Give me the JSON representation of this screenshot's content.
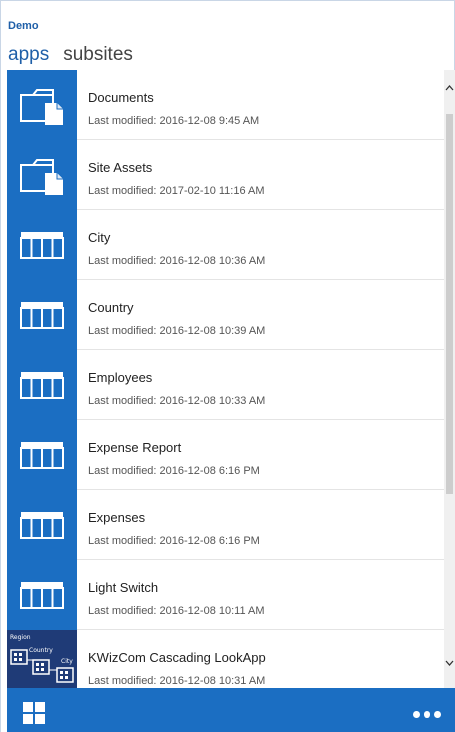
{
  "site": {
    "title": "Demo"
  },
  "tabs": [
    {
      "label": "apps",
      "active": true
    },
    {
      "label": "subsites",
      "active": false
    }
  ],
  "items": [
    {
      "name": "Documents",
      "modified": "Last modified: 2016-12-08 9:45 AM",
      "icon": "folder-document-icon"
    },
    {
      "name": "Site Assets",
      "modified": "Last modified: 2017-02-10 11:16 AM",
      "icon": "folder-document-icon"
    },
    {
      "name": "City",
      "modified": "Last modified: 2016-12-08 10:36 AM",
      "icon": "list-table-icon"
    },
    {
      "name": "Country",
      "modified": "Last modified: 2016-12-08 10:39 AM",
      "icon": "list-table-icon"
    },
    {
      "name": "Employees",
      "modified": "Last modified: 2016-12-08 10:33 AM",
      "icon": "list-table-icon"
    },
    {
      "name": "Expense Report",
      "modified": "Last modified: 2016-12-08 6:16 PM",
      "icon": "list-table-icon"
    },
    {
      "name": "Expenses",
      "modified": "Last modified: 2016-12-08 6:16 PM",
      "icon": "list-table-icon"
    },
    {
      "name": "Light Switch",
      "modified": "Last modified: 2016-12-08 10:11 AM",
      "icon": "list-table-icon"
    },
    {
      "name": "KWizCom Cascading LookApp",
      "modified": "Last modified: 2016-12-08 10:31 AM",
      "icon": "cascading-lookup-app-icon"
    }
  ],
  "kwizcom_icon": {
    "region": "Region",
    "country": "Country",
    "city": "City"
  },
  "colors": {
    "accent": "#1b6ec2",
    "title": "#1f5fa8",
    "app_tile_dark": "#1f3b77"
  }
}
